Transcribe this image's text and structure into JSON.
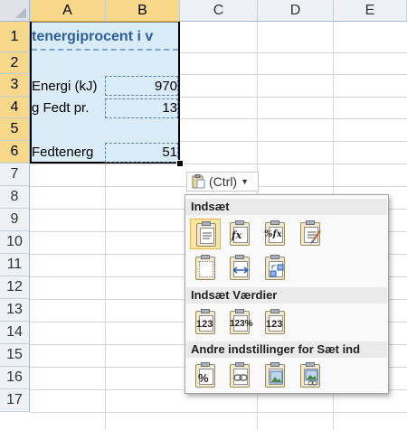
{
  "columns": [
    "A",
    "B",
    "C",
    "D",
    "E"
  ],
  "rows": [
    "1",
    "2",
    "3",
    "4",
    "5",
    "6",
    "7",
    "8",
    "9",
    "10",
    "11",
    "12",
    "13",
    "14",
    "15",
    "16",
    "17"
  ],
  "cells": {
    "a1": "tenergiprocent i v",
    "a3": "Energi (kJ)",
    "b3": "970",
    "a4": "g Fedt pr.",
    "b4": "13",
    "a6": "Fedtenerg",
    "b6": "51"
  },
  "paste_options_button": {
    "label": "(Ctrl)",
    "icon": "clipboard-icon",
    "dropdown_icon": "caret-down-icon"
  },
  "paste_menu": {
    "sections": [
      {
        "heading": "Indsæt",
        "buttons": [
          {
            "name": "paste",
            "icon": "paste-icon"
          },
          {
            "name": "formulas",
            "icon": "paste-formulas-icon",
            "glyph": "fx"
          },
          {
            "name": "formulas-number-format",
            "icon": "paste-formulas-number-format-icon",
            "glyph": "%fx"
          },
          {
            "name": "keep-source-formatting",
            "icon": "paste-keep-source-formatting-icon"
          },
          {
            "name": "no-borders",
            "icon": "paste-no-borders-icon"
          },
          {
            "name": "keep-column-widths",
            "icon": "paste-column-widths-icon"
          },
          {
            "name": "transpose",
            "icon": "paste-transpose-icon"
          }
        ]
      },
      {
        "heading": "Indsæt Værdier",
        "buttons": [
          {
            "name": "values",
            "icon": "paste-values-icon",
            "glyph": "123"
          },
          {
            "name": "values-number-format",
            "icon": "paste-values-number-format-icon",
            "glyph": "123%"
          },
          {
            "name": "values-source-formatting",
            "icon": "paste-values-source-formatting-icon",
            "glyph": "123"
          }
        ]
      },
      {
        "heading": "Andre indstillinger for Sæt ind",
        "buttons": [
          {
            "name": "formatting",
            "icon": "paste-formatting-icon",
            "glyph": "%"
          },
          {
            "name": "paste-link",
            "icon": "paste-link-icon"
          },
          {
            "name": "picture",
            "icon": "paste-picture-icon"
          },
          {
            "name": "linked-picture",
            "icon": "paste-linked-picture-icon"
          }
        ]
      }
    ]
  },
  "colors": {
    "title_text": "#2d5ea3",
    "selection_fill": "#d9ecf8",
    "header_selected": "#f7d78a",
    "active_button": "#fde7a5"
  }
}
